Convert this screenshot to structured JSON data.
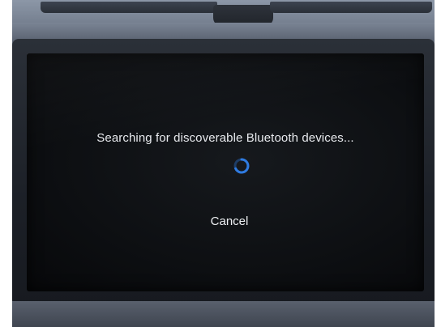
{
  "dialog": {
    "message": "Searching for discoverable Bluetooth devices...",
    "cancel_label": "Cancel"
  },
  "spinner": {
    "icon": "loading-spinner-icon",
    "color": "#2f7be0"
  }
}
